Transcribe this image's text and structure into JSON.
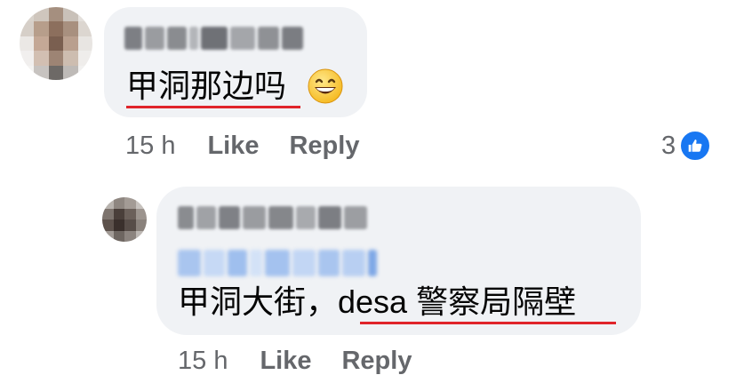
{
  "comment": {
    "avatar_icon": "blurred-profile-photo",
    "text": "甲洞那边吗",
    "emoji": "grinning-face-with-smiling-eyes",
    "time": "15 h",
    "like_label": "Like",
    "reply_label": "Reply",
    "reaction_count": "3",
    "reaction_icon": "thumbs-up-icon"
  },
  "reply": {
    "avatar_icon": "blurred-profile-photo",
    "text_prefix": "甲洞大街，",
    "text_underlined": "desa 警察局隔壁",
    "time": "15 h",
    "like_label": "Like",
    "reply_label": "Reply"
  },
  "colors": {
    "bubble": "#f0f2f5",
    "meta_text": "#65676b",
    "like_blue": "#1877f2",
    "underline_red": "#e0242a"
  }
}
